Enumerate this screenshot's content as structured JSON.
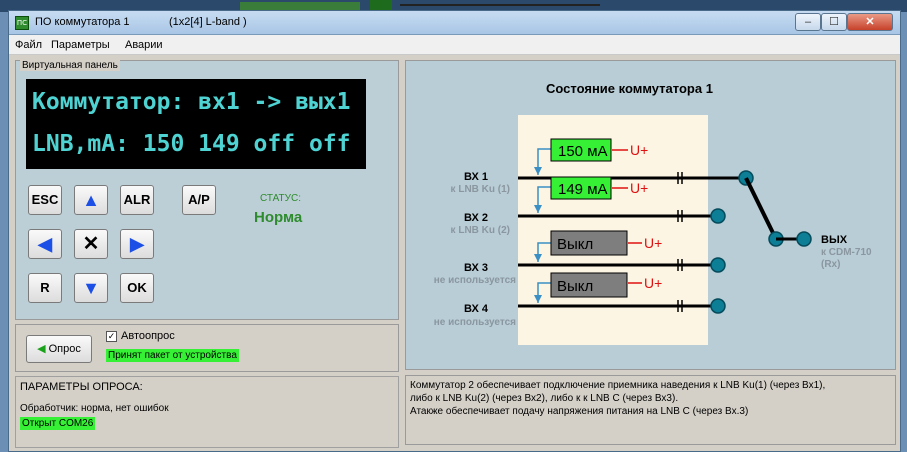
{
  "window": {
    "title": "ПО коммутатора 1",
    "subtitle": "(1x2[4] L-band )",
    "icon_text": "ПС"
  },
  "menu": [
    "Файл",
    "Параметры",
    "Аварии"
  ],
  "virtual_panel": {
    "label": "Виртуальная панель",
    "lcd_line1": "Коммутатор: вх1 -> вых1",
    "lcd_line2": "LNB,mA: 150 149 off off",
    "buttons": {
      "esc": "ESC",
      "alr": "ALR",
      "ap": "A/P",
      "r": "R",
      "ok": "OK"
    },
    "status_label": "СТАТУС:",
    "status_value": "Норма"
  },
  "poll": {
    "button_label": "Опрос",
    "autopoll_label": "Автоопрос",
    "autopoll_checked": true,
    "packet_status": "Принят пакет от устройства"
  },
  "params": {
    "heading": "ПАРАМЕТРЫ ОПРОСА:",
    "handler": "Обработчик: норма, нет ошибок",
    "port": "Открыт COM26"
  },
  "diagram": {
    "title": "Состояние коммутатора 1",
    "inputs": [
      {
        "name": "ВХ 1",
        "sub": "к LNB Ku (1)",
        "current": "150 мА",
        "power": "U+",
        "active": true
      },
      {
        "name": "ВХ 2",
        "sub": "к LNB Ku (2)",
        "current": "149 мА",
        "power": "U+",
        "active": true
      },
      {
        "name": "ВХ 3",
        "sub": "не используется",
        "current": "Выкл",
        "power": "U+",
        "active": false
      },
      {
        "name": "ВХ 4",
        "sub": "не используется",
        "current": "Выкл",
        "power": "U+",
        "active": false
      }
    ],
    "output": {
      "name": "ВЫХ",
      "sub1": "к CDM-710",
      "sub2": "(Rx)"
    }
  },
  "description": {
    "line1": "Коммутатор 2 обеспечивает подключение приемника наведения к LNB Ku(1) (через Вх1),",
    "line2": "либо к LNB Ku(2) (через Вх2),  либо к к LNB C (через Вх3).",
    "line3": "Атакже обеспечивает подачу напряжения питания на LNB C (через Вх.3)"
  },
  "colors": {
    "lcd_text": "#4fd2d2",
    "ok_green": "#35f035",
    "status_green": "#2e8b2e",
    "power_red": "#e01010",
    "arrow_blue": "#1c4fe6",
    "wire_blue": "#3a8fc4"
  }
}
